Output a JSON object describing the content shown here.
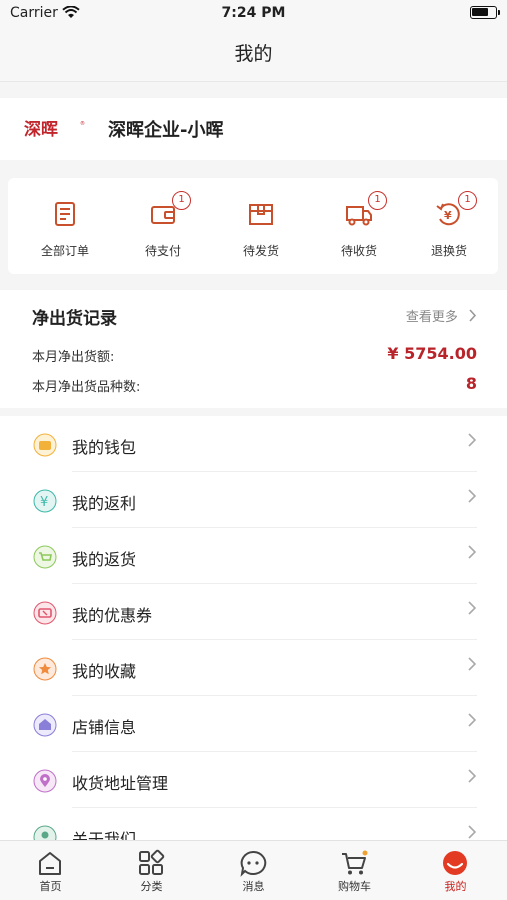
{
  "status_bar": {
    "carrier": "Carrier",
    "time": "7:24 PM"
  },
  "nav": {
    "title": "我的"
  },
  "profile": {
    "company_name": "深晖企业-小晖",
    "logo_text": "深晖"
  },
  "orders": [
    {
      "label": "全部订单",
      "icon": "order-list-icon"
    },
    {
      "label": "待支付",
      "icon": "wallet-icon",
      "badge": "1"
    },
    {
      "label": "待发货",
      "icon": "box-icon"
    },
    {
      "label": "待收货",
      "icon": "truck-icon",
      "badge": "1"
    },
    {
      "label": "退换货",
      "icon": "return-icon",
      "badge": "1"
    }
  ],
  "shipping": {
    "title": "净出货记录",
    "more": "查看更多",
    "rows": [
      {
        "label": "本月净出货额:",
        "value": "¥ 5754.00"
      },
      {
        "label": "本月净出货品种数:",
        "value": "8"
      }
    ]
  },
  "menu": [
    {
      "label": "我的钱包",
      "icon": "wallet-icon",
      "color": "#f2b23a"
    },
    {
      "label": "我的返利",
      "icon": "yen-icon",
      "color": "#3cb8a8"
    },
    {
      "label": "我的返货",
      "icon": "cart-icon",
      "color": "#8cc85a"
    },
    {
      "label": "我的优惠券",
      "icon": "coupon-icon",
      "color": "#e0566c"
    },
    {
      "label": "我的收藏",
      "icon": "star-icon",
      "color": "#f08a3c"
    },
    {
      "label": "店铺信息",
      "icon": "shop-icon",
      "color": "#8a7fd8"
    },
    {
      "label": "收货地址管理",
      "icon": "location-icon",
      "color": "#c070c8"
    },
    {
      "label": "关于我们",
      "icon": "info-icon",
      "color": "#5aa888"
    }
  ],
  "tabs": [
    {
      "label": "首页",
      "icon": "home-icon"
    },
    {
      "label": "分类",
      "icon": "category-icon"
    },
    {
      "label": "消息",
      "icon": "message-icon"
    },
    {
      "label": "购物车",
      "icon": "cart-icon"
    },
    {
      "label": "我的",
      "icon": "profile-icon",
      "active": true
    }
  ],
  "colors": {
    "accent": "#c8201e",
    "value_red": "#b8242a"
  }
}
